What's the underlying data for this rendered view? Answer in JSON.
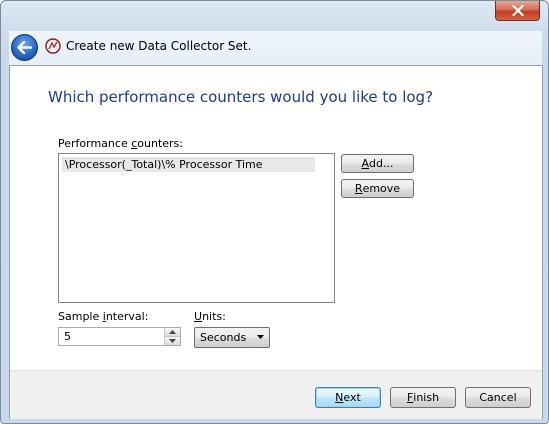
{
  "header": {
    "title": "Create new Data Collector Set."
  },
  "main": {
    "question": "Which performance counters would you like to log?",
    "counters_label_pre": "Performance ",
    "counters_label_accel": "c",
    "counters_label_post": "ounters:",
    "counters": [
      "\\Processor(_Total)\\% Processor Time"
    ],
    "add_label_accel": "A",
    "add_label_post": "dd...",
    "remove_label_accel": "R",
    "remove_label_post": "emove",
    "sample_label_pre": "Sample ",
    "sample_label_accel": "i",
    "sample_label_post": "nterval:",
    "sample_value": "5",
    "units_label_accel": "U",
    "units_label_post": "nits:",
    "units_value": "Seconds"
  },
  "footer": {
    "next_accel": "N",
    "next_post": "ext",
    "finish_accel": "F",
    "finish_post": "inish",
    "cancel_label": "Cancel"
  },
  "colors": {
    "question_text": "#1e3a9a",
    "close_button": "#c0391f"
  },
  "icons": [
    "back-arrow-icon",
    "performance-monitor-icon",
    "close-icon",
    "spin-up-icon",
    "spin-down-icon",
    "dropdown-arrow-icon"
  ]
}
